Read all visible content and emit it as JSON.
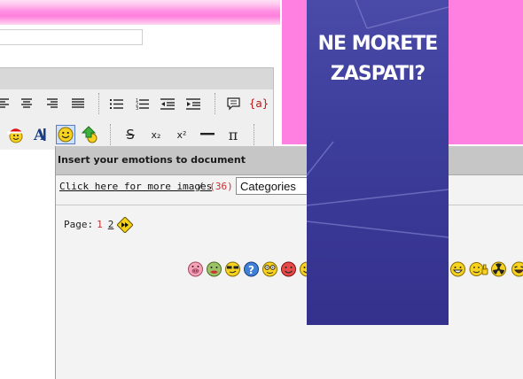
{
  "ad": {
    "headline": "NE MORETE ZASPATI?"
  },
  "toolbar": {
    "row1": [
      "align-left-icon",
      "align-center-icon",
      "align-right-icon",
      "align-justify-icon",
      "bulleted-list-icon",
      "numbered-list-icon",
      "outdent-icon",
      "indent-icon",
      "comment-icon",
      "variable-icon"
    ],
    "variable_label": "{a}",
    "row2": [
      "santa-smiley-icon",
      "font-color-icon",
      "insert-emotion-icon",
      "upload-icon",
      "strikethrough-icon",
      "subscript-icon",
      "superscript-icon",
      "horizontal-rule-icon",
      "pi-icon"
    ],
    "strike_label": "S",
    "sub_label": "x₂",
    "sup_label": "x²",
    "pi_label": "π"
  },
  "dialog": {
    "title": "Insert your emotions to document",
    "more_link": "Click here for more images",
    "separator": "/",
    "count": "(36)",
    "category_select": "Categories",
    "page_label": "Page:",
    "pages": [
      "1",
      "2"
    ],
    "next_icon": "fast-forward-icon"
  },
  "emoticons": [
    "pig-icon",
    "sick-icon",
    "cool-icon",
    "question-icon",
    "nerd-icon",
    "devil-icon",
    "smile-icon",
    "grin-icon",
    "thumbs-up-icon",
    "radioactive-icon",
    "laugh-icon"
  ],
  "colors": {
    "pink": "#ff80e0",
    "ad_blue": "#3d3e9b",
    "dialog_bg": "#f3f3f3",
    "title_bar": "#c6c6c6",
    "count_red": "#c43030"
  }
}
